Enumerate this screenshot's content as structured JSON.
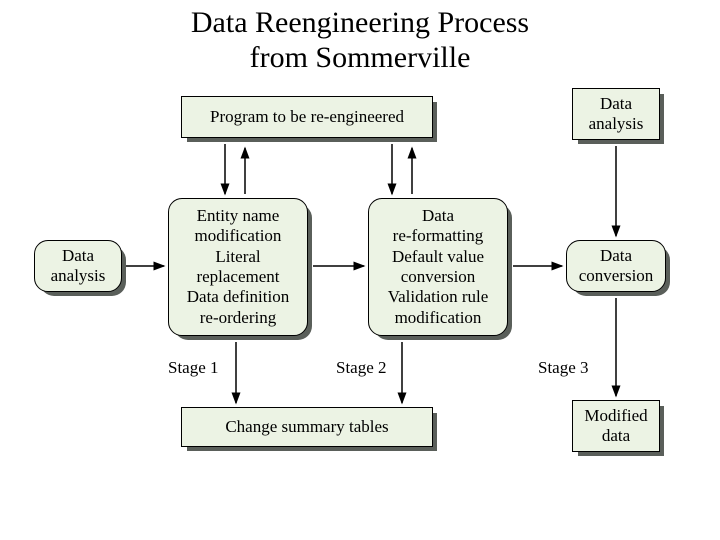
{
  "title_line1": "Data Reengineering Process",
  "title_line2": "from Sommerville",
  "nodes": {
    "program": "Program to be re-engineered",
    "data_analysis_top": "Data\nanalysis",
    "data_analysis_left": "Data\nanalysis",
    "stage1_box": "Entity name\nmodification\nLiteral\nreplacement\nData definition\nre-ordering",
    "stage2_box": "Data\nre-formatting\nDefault value\nconversion\nValidation rule\nmodification",
    "data_conversion": "Data\nconversion",
    "change_summary": "Change summary tables",
    "modified_data": "Modified\ndata"
  },
  "labels": {
    "stage1": "Stage 1",
    "stage2": "Stage 2",
    "stage3": "Stage 3"
  }
}
